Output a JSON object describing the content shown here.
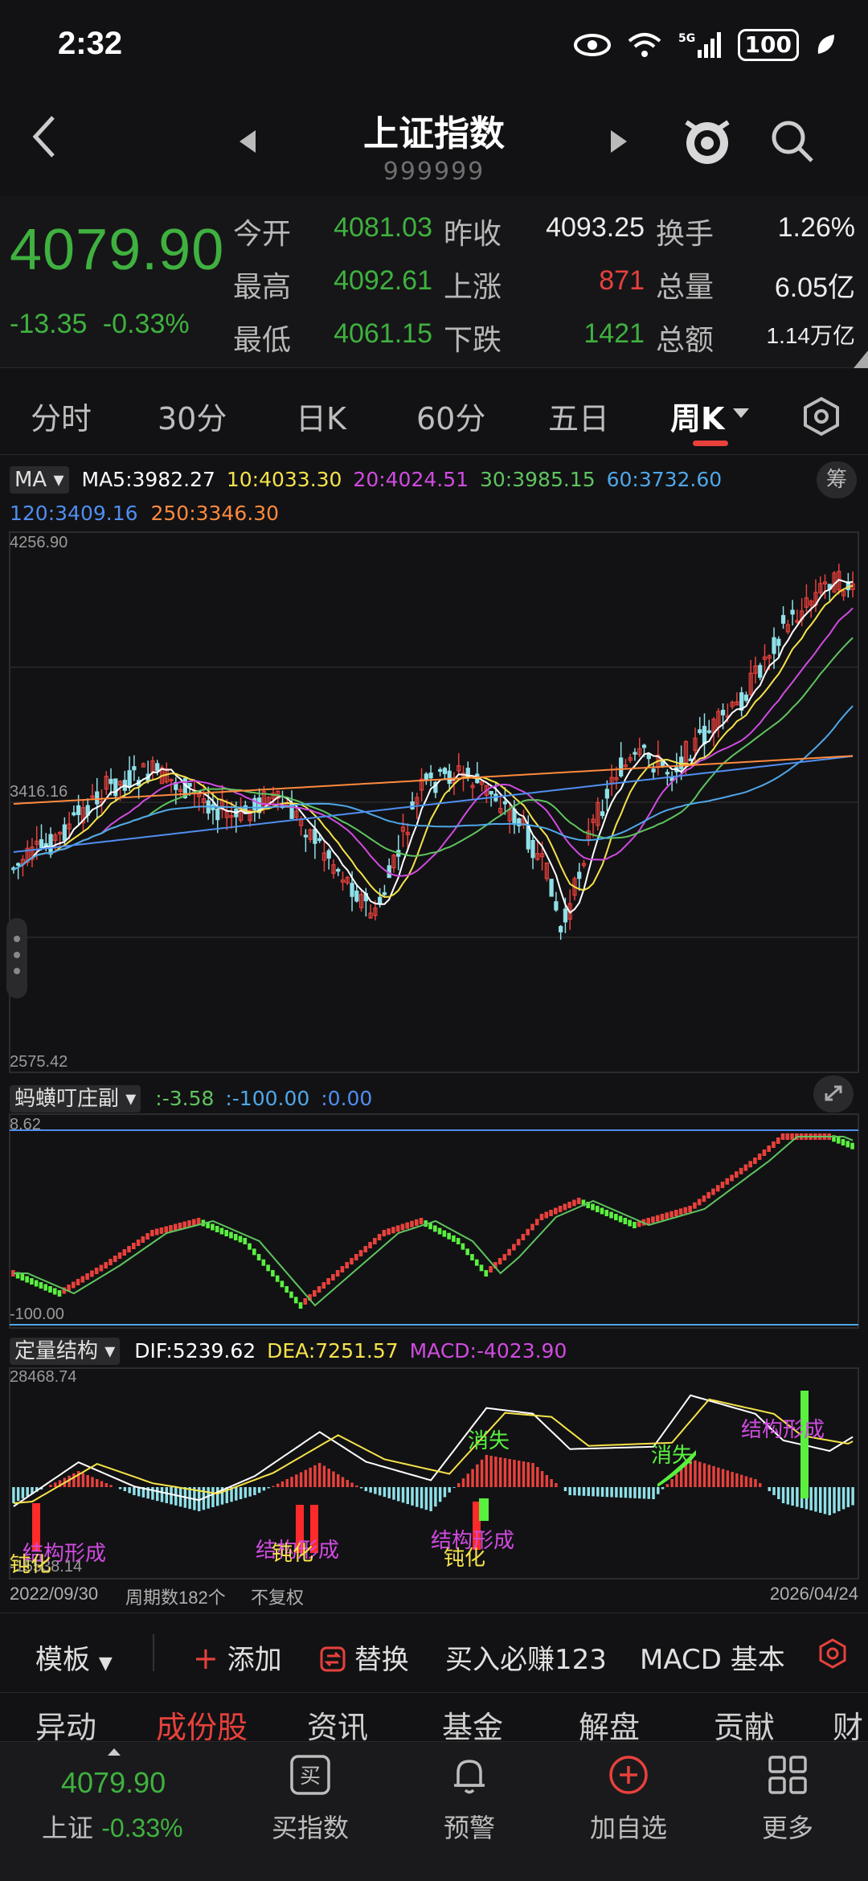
{
  "status": {
    "time": "2:32",
    "battery": "100"
  },
  "header": {
    "title": "上证指数",
    "code": "999999"
  },
  "quote": {
    "price": "4079.90",
    "change": "-13.35",
    "change_pct": "-0.33%",
    "rows": [
      [
        {
          "label": "今开",
          "value": "4081.03",
          "color": "green"
        },
        {
          "label": "昨收",
          "value": "4093.25",
          "color": "white"
        },
        {
          "label": "换手",
          "value": "1.26%",
          "color": "white"
        }
      ],
      [
        {
          "label": "最高",
          "value": "4092.61",
          "color": "green"
        },
        {
          "label": "上涨",
          "value": "871",
          "color": "red"
        },
        {
          "label": "总量",
          "value": "6.05亿",
          "color": "white"
        }
      ],
      [
        {
          "label": "最低",
          "value": "4061.15",
          "color": "green"
        },
        {
          "label": "下跌",
          "value": "1421",
          "color": "green"
        },
        {
          "label": "总额",
          "value": "1.14万亿",
          "color": "white"
        }
      ]
    ]
  },
  "tabs": [
    "分时",
    "30分",
    "日K",
    "60分",
    "五日",
    "周K"
  ],
  "active_tab": "周K",
  "ma_indicator": {
    "selector": "MA",
    "ma5": "MA5:3982.27",
    "ma10": "10:4033.30",
    "ma20": "20:4024.51",
    "ma30": "30:3985.15",
    "ma60": "60:3732.60",
    "ma120": "120:3409.16",
    "ma250": "250:3346.30",
    "chips_label": "筹",
    "colors": {
      "ma5": "#ffffff",
      "ma10": "#f5e24a",
      "ma20": "#d04be0",
      "ma30": "#5fc45f",
      "ma60": "#4fa7e8",
      "ma120": "#4f8ef0",
      "ma250": "#ff8a3d"
    }
  },
  "main_chart": {
    "y_labels": [
      "4256.90",
      "3416.16",
      "2575.42"
    ]
  },
  "sub_indicator1": {
    "selector": "蚂蟥叮庄副",
    "v1": ":-3.58",
    "v2": ":-100.00",
    "v3": ":0.00",
    "top_label": "8.62",
    "bottom_label": "-100.00"
  },
  "sub_indicator2": {
    "selector": "定量结构",
    "dif": "DIF:5239.62",
    "dea": "DEA:7251.57",
    "macd": "MACD:-4023.90",
    "top_label": "28468.74",
    "bottom_label": "-15538.14",
    "annotations": [
      "结构形成",
      "钝化",
      "结构形成",
      "钝化",
      "结构形成",
      "钝化",
      "消失",
      "消失",
      "结构形成"
    ]
  },
  "footer_axis": {
    "start": "2022/09/30",
    "count": "周期数182个",
    "adjust": "不复权",
    "end": "2026/04/24"
  },
  "toolbar": {
    "template": "模板",
    "add": "添加",
    "replace": "替换",
    "buy": "买入必赚123",
    "macd": "MACD 基本"
  },
  "bottom_tabs": [
    "异动",
    "成份股",
    "资讯",
    "基金",
    "解盘",
    "贡献",
    "财"
  ],
  "active_bottom_tab": "成份股",
  "bottom_nav": {
    "price": "4079.90",
    "name": "上证",
    "pct": "-0.33%",
    "items": [
      "买指数",
      "预警",
      "加自选",
      "更多"
    ]
  }
}
